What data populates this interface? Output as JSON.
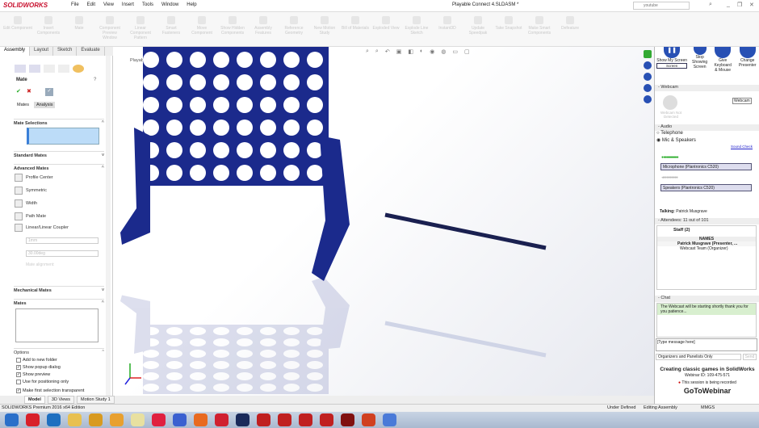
{
  "app": {
    "logo": "SOLIDWORKS",
    "title": "Playable Connect 4.SLDASM *",
    "search_placeholder": "youtube",
    "menu": [
      "File",
      "Edit",
      "View",
      "Insert",
      "Tools",
      "Window",
      "Help"
    ]
  },
  "ribbon": [
    "Edit Component",
    "Insert Components",
    "Mate",
    "Component Preview Window",
    "Linear Component Pattern",
    "Smart Fasteners",
    "Move Component",
    "Show Hidden Components",
    "Assembly Features",
    "Reference Geometry",
    "New Motion Study",
    "Bill of Materials",
    "Exploded View",
    "Explode Line Sketch",
    "Instant3D",
    "Update Speedpak",
    "Take Snapshot",
    "Make Smart Components",
    "Defeature"
  ],
  "cm_tabs": [
    "Assembly",
    "Layout",
    "Sketch",
    "Evaluate"
  ],
  "property": {
    "title": "Mate",
    "tabs": [
      "Mates",
      "Analysis"
    ],
    "sections": {
      "selections": "Mate Selections",
      "standard": "Standard Mates",
      "advanced": "Advanced Mates",
      "mechanical": "Mechanical Mates",
      "mates": "Mates",
      "options": "Options"
    },
    "advanced_items": [
      "Profile Center",
      "Symmetric",
      "Width",
      "Path Mate",
      "Linear/Linear Coupler"
    ],
    "distance": "1mm",
    "angle": "30.00deg",
    "alignment": "Mate alignment:",
    "options": [
      {
        "label": "Add to new folder",
        "checked": false
      },
      {
        "label": "Show popup dialog",
        "checked": true
      },
      {
        "label": "Show preview",
        "checked": true
      },
      {
        "label": "Use for positioning only",
        "checked": false
      },
      {
        "label": "Make first selection transparent",
        "checked": true
      }
    ]
  },
  "viewport": {
    "tree_label": "Playable Connect 4"
  },
  "bottom_tabs": [
    "Model",
    "3D Views",
    "Motion Study 1"
  ],
  "status": {
    "edition": "SOLIDWORKS Premium 2016 x64 Edition",
    "state": "Under Defined",
    "mode": "Editing Assembly",
    "units": "MMGS"
  },
  "webinar": {
    "controls": [
      "Show My Screen",
      "Stop Showing Screen",
      "Give Keyboard & Mouse",
      "Change Presenter"
    ],
    "screen_select": "Screen",
    "webcam": {
      "header": "Webcam",
      "not_detected": "Webcam Not Detected",
      "button": "Webcam"
    },
    "audio": {
      "header": "Audio",
      "telephone": "Telephone",
      "mic": "Mic & Speakers",
      "sound_check": "Sound Check",
      "microphone": "Microphone (Plantronics C520)",
      "speakers": "Speakers (Plantronics C520)",
      "talking_label": "Talking:",
      "talking": "Patrick Musgrave"
    },
    "attendees": {
      "header": "Attendees: 11 out of 101",
      "staff": "Staff (2)",
      "names_col": "NAMES",
      "rows": [
        "Patrick Musgrave (Presenter, ...",
        "Webcast Team (Organizer)"
      ]
    },
    "chat": {
      "header": "Chat",
      "message": "The Webcast will be starting shortly thank you for you patience...",
      "input": "[Type message here]",
      "recipient": "Organizers and Panelists Only",
      "send": "Send"
    },
    "footer": {
      "title": "Creating classic games in SolidWorks",
      "webinar_id": "Webinar ID: 109-475-571",
      "recording": "This session is being recorded",
      "brand": "GoToWebinar"
    }
  },
  "colors": {
    "board": "#1b2a8c",
    "accent": "#c8102e",
    "webinar_blue": "#2850b4"
  }
}
